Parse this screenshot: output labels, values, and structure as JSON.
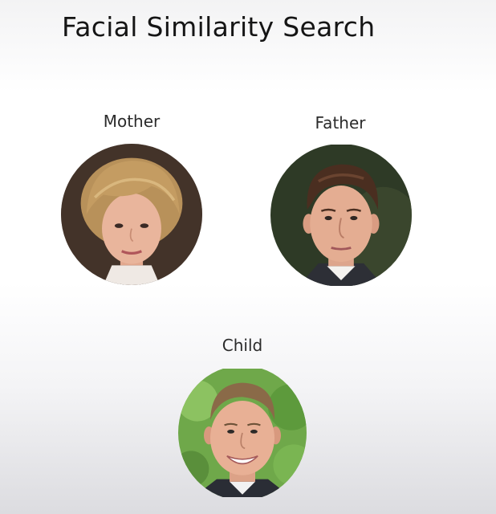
{
  "title": "Facial Similarity Search",
  "people": {
    "mother": {
      "label": "Mother"
    },
    "father": {
      "label": "Father"
    },
    "child": {
      "label": "Child"
    }
  }
}
